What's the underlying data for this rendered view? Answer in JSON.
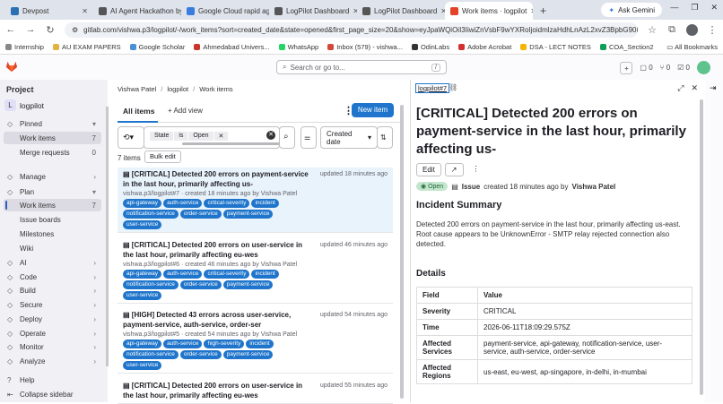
{
  "browser": {
    "tabs": [
      {
        "label": "Devpost",
        "color": "#2c6fb4"
      },
      {
        "label": "AI Agent Hackathon by",
        "color": "#555555"
      },
      {
        "label": "Google Cloud rapid ag",
        "color": "#3a7be0"
      },
      {
        "label": "LogPilot Dashboard",
        "color": "#555555"
      },
      {
        "label": "LogPilot Dashboard",
        "color": "#555555"
      },
      {
        "label": "Work items · logpilot",
        "color": "#e24329"
      }
    ],
    "ask_gemini": "Ask Gemini",
    "url": "gitlab.com/vishwa.p3/logpilot/-/work_items?sort=created_date&state=opened&first_page_size=20&show=eyJpaWQiOiI3IiwiZnVsbF9wYXRoIjoidmlzaHdhLnAzL2xvZ3BpbG90IiwiaWQiOjE...",
    "bookmarks": [
      "Internship",
      "AU EXAM PAPERS",
      "Google Scholar",
      "Ahmedabad Univers...",
      "WhatsApp",
      "Inbox (579) - vishwa...",
      "OdinLabs",
      "Adobe Acrobat",
      "DSA - LECT NOTES",
      "COA_Section2"
    ],
    "all_bookmarks": "All Bookmarks"
  },
  "gitlab": {
    "search_placeholder": "Search or go to...",
    "search_shortcut": "/",
    "counters": {
      "issues": "0",
      "mrs": "0",
      "todos": "0"
    }
  },
  "sidebar": {
    "section": "Project",
    "project_initial": "L",
    "project_name": "logpilot",
    "items": [
      {
        "label": "Pinned",
        "type": "group",
        "count": ""
      },
      {
        "label": "Work items",
        "type": "sub",
        "count": "7"
      },
      {
        "label": "Merge requests",
        "type": "sub",
        "count": "0"
      },
      {
        "label": "Manage",
        "type": "group",
        "count": ""
      },
      {
        "label": "Plan",
        "type": "group",
        "count": ""
      },
      {
        "label": "Work items",
        "type": "sub-active",
        "count": "7"
      },
      {
        "label": "Issue boards",
        "type": "sub",
        "count": ""
      },
      {
        "label": "Milestones",
        "type": "sub",
        "count": ""
      },
      {
        "label": "Wiki",
        "type": "sub",
        "count": ""
      },
      {
        "label": "AI",
        "type": "group",
        "count": ""
      },
      {
        "label": "Code",
        "type": "group",
        "count": ""
      },
      {
        "label": "Build",
        "type": "group",
        "count": ""
      },
      {
        "label": "Secure",
        "type": "group",
        "count": ""
      },
      {
        "label": "Deploy",
        "type": "group",
        "count": ""
      },
      {
        "label": "Operate",
        "type": "group",
        "count": ""
      },
      {
        "label": "Monitor",
        "type": "group",
        "count": ""
      },
      {
        "label": "Analyze",
        "type": "group",
        "count": ""
      }
    ],
    "help": "Help",
    "collapse": "Collapse sidebar"
  },
  "list": {
    "breadcrumb": [
      "Vishwa Patel",
      "logpilot",
      "Work items"
    ],
    "tab_all": "All items",
    "add_view": "+ Add view",
    "new_item": "New item",
    "filter": {
      "field": "State",
      "op": "is",
      "value": "Open"
    },
    "sort": "Created date",
    "count_label": "7 items",
    "bulk_edit": "Bulk edit",
    "items": [
      {
        "title": "[CRITICAL] Detected 200 errors on payment-service in the last hour, primarily affecting us-",
        "updated": "updated 18 minutes ago",
        "meta": "vishwa.p3/logpilot#7 · created 18 minutes ago by Vishwa Patel",
        "labels": [
          "api-gateway",
          "auth-service",
          "critical-severity",
          "incident",
          "notification-service",
          "order-service",
          "payment-service",
          "user-service"
        ]
      },
      {
        "title": "[CRITICAL] Detected 200 errors on user-service in the last hour, primarily affecting eu-wes",
        "updated": "updated 46 minutes ago",
        "meta": "vishwa.p3/logpilot#6 · created 46 minutes ago by Vishwa Patel",
        "labels": [
          "api-gateway",
          "auth-service",
          "critical-severity",
          "incident",
          "notification-service",
          "order-service",
          "payment-service",
          "user-service"
        ]
      },
      {
        "title": "[HIGH] Detected 43 errors across user-service, payment-service, auth-service, order-ser",
        "updated": "updated 54 minutes ago",
        "meta": "vishwa.p3/logpilot#5 · created 54 minutes ago by Vishwa Patel",
        "labels": [
          "api-gateway",
          "auth-service",
          "high-severity",
          "incident",
          "notification-service",
          "order-service",
          "payment-service",
          "user-service"
        ]
      },
      {
        "title": "[CRITICAL] Detected 200 errors on user-service in the last hour, primarily affecting eu-wes",
        "updated": "updated 55 minutes ago",
        "meta": "",
        "labels": []
      }
    ]
  },
  "detail": {
    "ref": "logpilot#7",
    "title": "[CRITICAL] Detected 200 errors on payment-service in the last hour, primarily affecting us-",
    "edit": "Edit",
    "status": "Open",
    "type": "Issue",
    "created": "created 18 minutes ago by",
    "author": "Vishwa Patel",
    "summary_heading": "Incident Summary",
    "summary": "Detected 200 errors on payment-service in the last hour, primarily affecting us-east. Root cause appears to be UnknownError - SMTP relay rejected connection also detected.",
    "details_heading": "Details",
    "table_head": {
      "field": "Field",
      "value": "Value"
    },
    "rows": [
      {
        "field": "Severity",
        "value": "CRITICAL"
      },
      {
        "field": "Time",
        "value": "2026-06-11T18:09:29.575Z"
      },
      {
        "field": "Affected Services",
        "value": "payment-service, api-gateway, notification-service, user-service, auth-service, order-service"
      },
      {
        "field": "Affected Regions",
        "value": "us-east, eu-west, ap-singapore, in-delhi, in-mumbai"
      }
    ]
  },
  "colors": {
    "accent": "#1f75cb",
    "label": "#1f75cb",
    "sidebar": "#f1f0f5",
    "selected": "#e9f3fc"
  }
}
